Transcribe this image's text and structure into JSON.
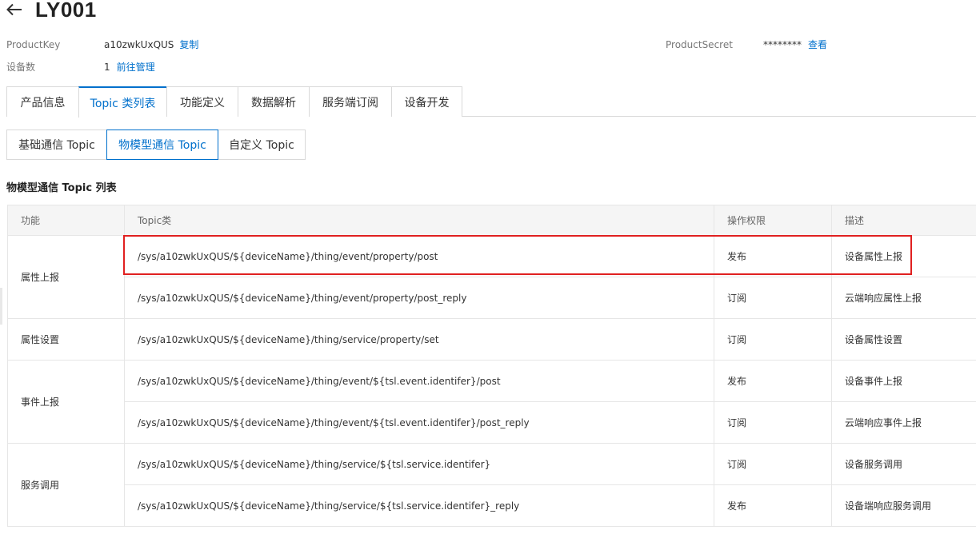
{
  "header": {
    "back_icon": "arrow-left-icon",
    "title": "LY001"
  },
  "meta": {
    "product_key_label": "ProductKey",
    "product_key_value": "a10zwkUxQUS",
    "copy_label": "复制",
    "device_count_label": "设备数",
    "device_count_value": "1",
    "manage_label": "前往管理",
    "product_secret_label": "ProductSecret",
    "product_secret_value": "********",
    "view_label": "查看"
  },
  "tabs": [
    {
      "label": "产品信息"
    },
    {
      "label": "Topic 类列表",
      "active": true
    },
    {
      "label": "功能定义"
    },
    {
      "label": "数据解析"
    },
    {
      "label": "服务端订阅"
    },
    {
      "label": "设备开发"
    }
  ],
  "subtabs": [
    {
      "label": "基础通信 Topic"
    },
    {
      "label": "物模型通信 Topic",
      "active": true
    },
    {
      "label": "自定义 Topic"
    }
  ],
  "section_title": "物模型通信 Topic 列表",
  "table": {
    "headers": [
      "功能",
      "Topic类",
      "操作权限",
      "描述"
    ],
    "groups": [
      {
        "function": "属性上报",
        "rows": [
          {
            "topic": "/sys/a10zwkUxQUS/${deviceName}/thing/event/property/post",
            "permission": "发布",
            "desc": "设备属性上报",
            "highlighted": true
          },
          {
            "topic": "/sys/a10zwkUxQUS/${deviceName}/thing/event/property/post_reply",
            "permission": "订阅",
            "desc": "云端响应属性上报"
          }
        ]
      },
      {
        "function": "属性设置",
        "rows": [
          {
            "topic": "/sys/a10zwkUxQUS/${deviceName}/thing/service/property/set",
            "permission": "订阅",
            "desc": "设备属性设置"
          }
        ]
      },
      {
        "function": "事件上报",
        "rows": [
          {
            "topic": "/sys/a10zwkUxQUS/${deviceName}/thing/event/${tsl.event.identifer}/post",
            "permission": "发布",
            "desc": "设备事件上报"
          },
          {
            "topic": "/sys/a10zwkUxQUS/${deviceName}/thing/event/${tsl.event.identifer}/post_reply",
            "permission": "订阅",
            "desc": "云端响应事件上报"
          }
        ]
      },
      {
        "function": "服务调用",
        "rows": [
          {
            "topic": "/sys/a10zwkUxQUS/${deviceName}/thing/service/${tsl.service.identifer}",
            "permission": "订阅",
            "desc": "设备服务调用"
          },
          {
            "topic": "/sys/a10zwkUxQUS/${deviceName}/thing/service/${tsl.service.identifer}_reply",
            "permission": "发布",
            "desc": "设备端响应服务调用"
          }
        ]
      }
    ]
  },
  "colors": {
    "accent": "#0070cc",
    "highlight": "#e02020",
    "header_bg": "#f5f5f5"
  }
}
